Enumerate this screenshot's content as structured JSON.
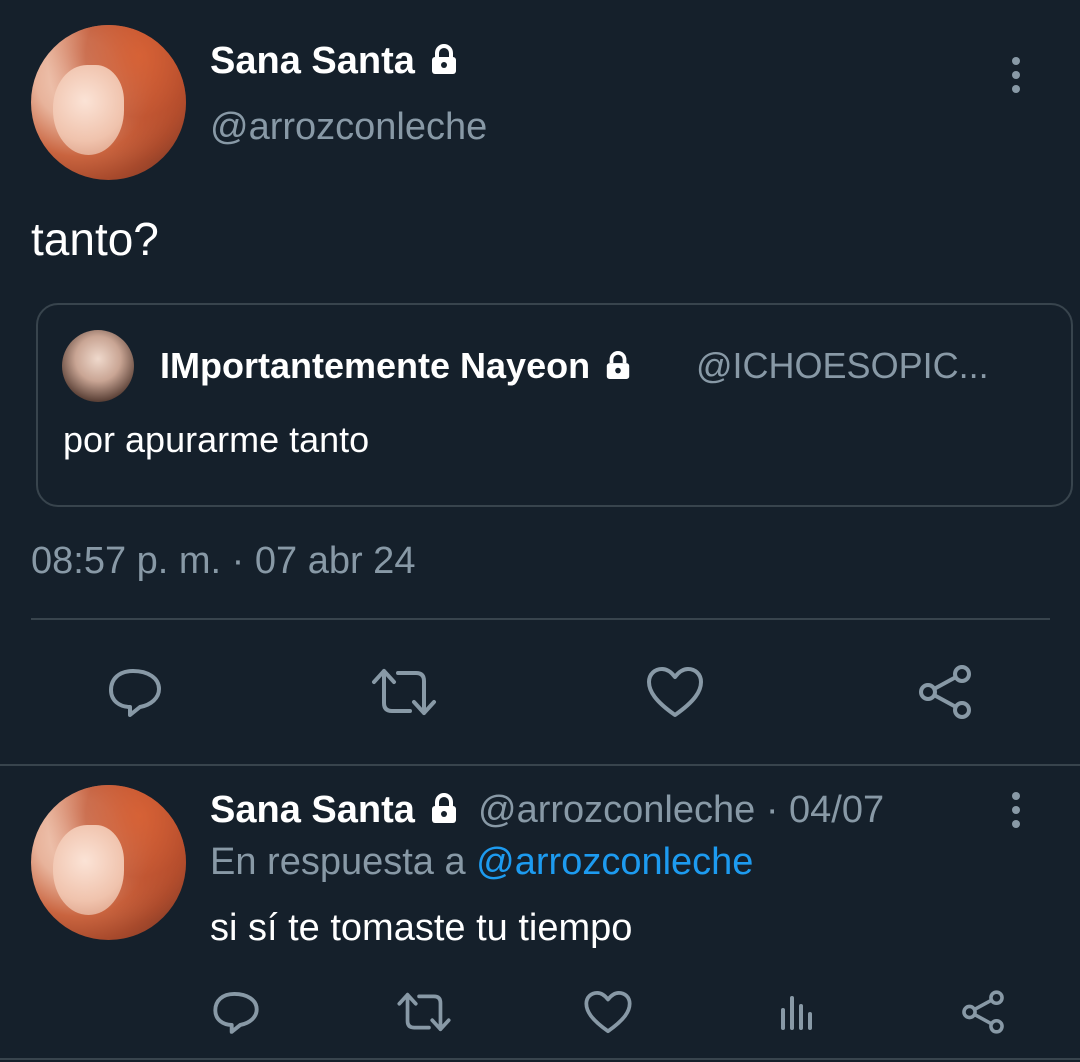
{
  "main_tweet": {
    "display_name": "Sana Santa",
    "handle": "@arrozconleche",
    "text": "tanto?",
    "timestamp": "08:57 p. m. · 07 abr 24",
    "quote": {
      "display_name": "IMportantemente Nayeon",
      "handle": "@ICHOESOPIC...",
      "text": "por apurarme tanto"
    }
  },
  "actions": {
    "reply_icon": "reply-icon",
    "retweet_icon": "retweet-icon",
    "like_icon": "heart-icon",
    "share_icon": "share-icon",
    "views_icon": "views-icon"
  },
  "reply_tweet": {
    "display_name": "Sana Santa",
    "handle_date": "@arrozconleche · 04/07",
    "reply_prefix": "En respuesta a ",
    "reply_to": "@arrozconleche",
    "text": "si sí te tomaste tu tiempo"
  },
  "colors": {
    "background": "#15202b",
    "muted": "#8899a6",
    "accent": "#1d9bf0",
    "border": "#38444d"
  }
}
